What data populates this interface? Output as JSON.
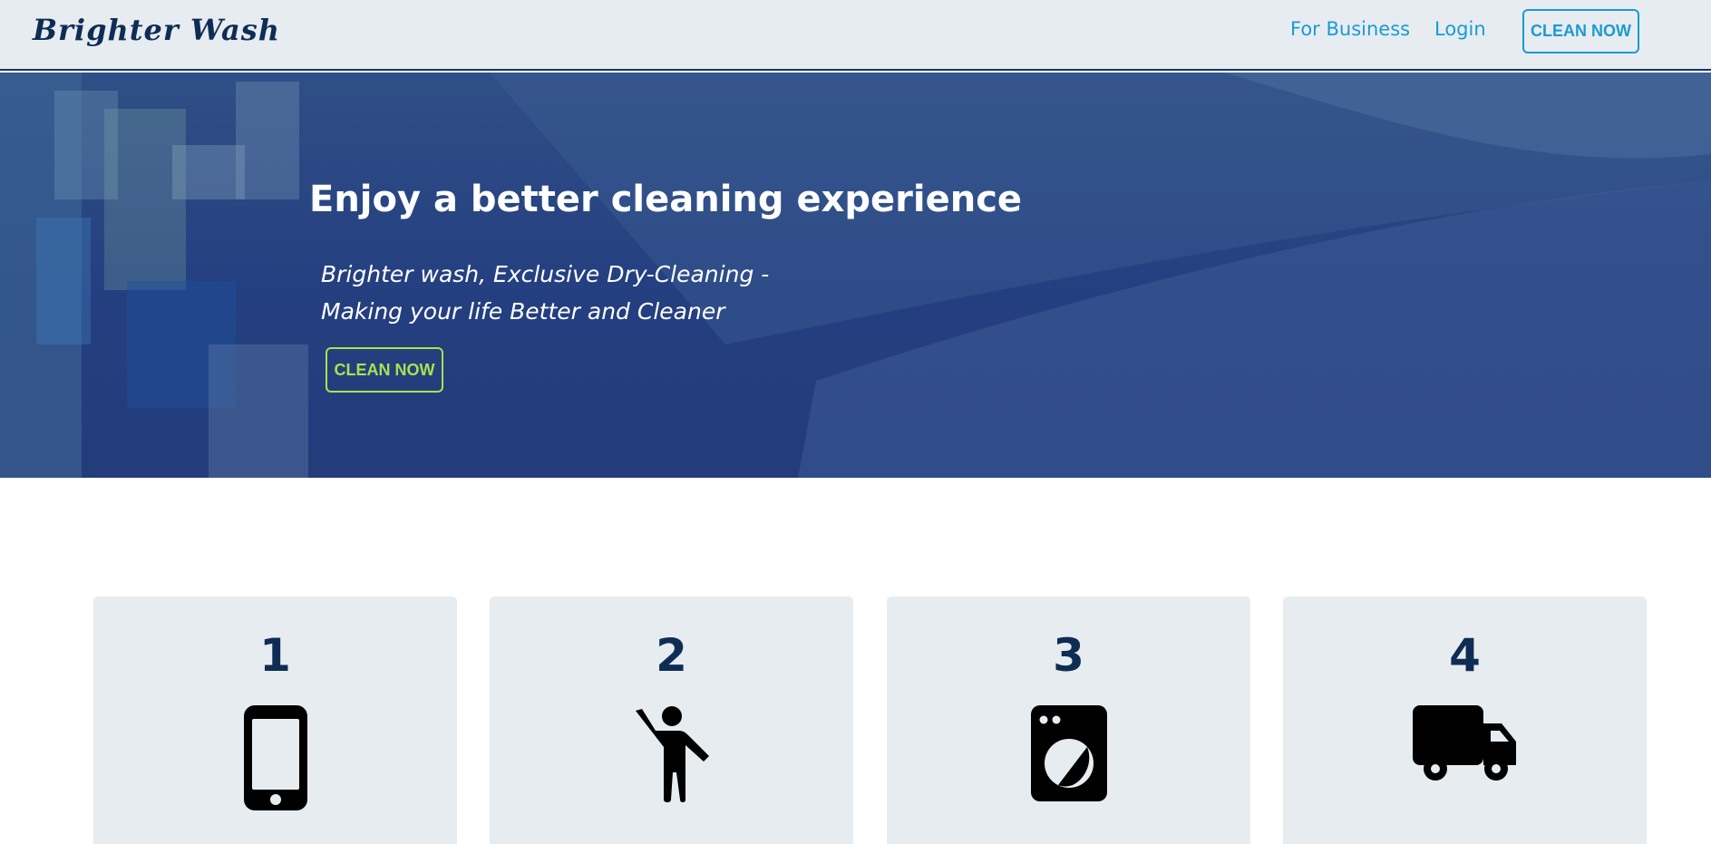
{
  "nav": {
    "brand": "Brighter Wash",
    "links": [
      "For Business",
      "Login"
    ],
    "cta": "CLEAN NOW"
  },
  "hero": {
    "title": "Enjoy a better cleaning experience",
    "subtitle_lines": [
      "Brighter wash, Exclusive Dry-Cleaning -",
      "Making your life Better and Cleaner"
    ],
    "cta": "CLEAN NOW"
  },
  "steps": [
    {
      "number": "1",
      "icon": "smartphone-icon"
    },
    {
      "number": "2",
      "icon": "person-waving-icon"
    },
    {
      "number": "3",
      "icon": "washing-machine-icon"
    },
    {
      "number": "4",
      "icon": "delivery-truck-icon"
    }
  ],
  "colors": {
    "brand_navy": "#0f2d54",
    "link_blue": "#1a9bd1",
    "hero_blue": "#243f80",
    "hero_button_green": "#a6e34e",
    "card_bg": "#e7ecf1"
  }
}
